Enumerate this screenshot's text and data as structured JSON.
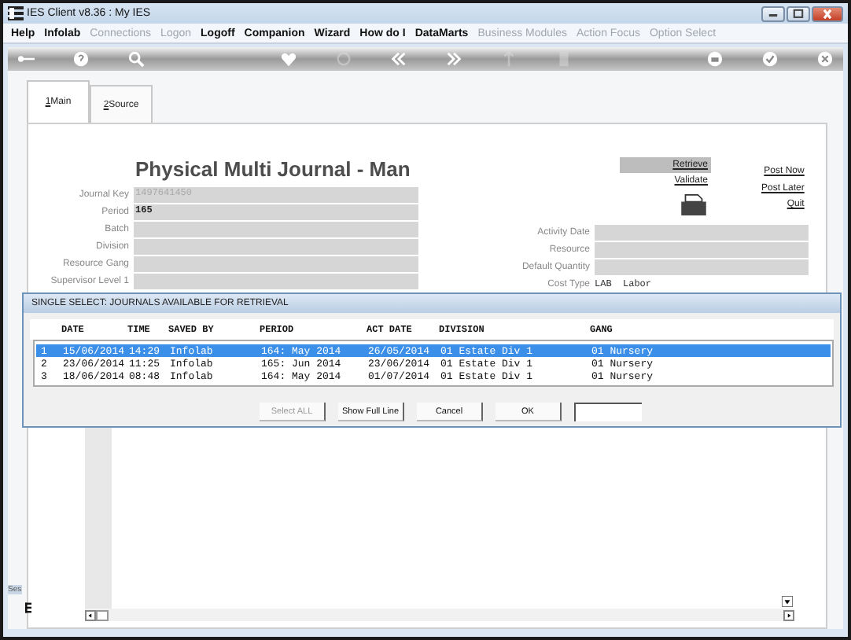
{
  "window": {
    "title": "IES Client v8.36 : My IES"
  },
  "menu": [
    {
      "label": "Help",
      "disabled": false
    },
    {
      "label": "Infolab",
      "disabled": false
    },
    {
      "label": "Connections",
      "disabled": true
    },
    {
      "label": "Logon",
      "disabled": true
    },
    {
      "label": "Logoff",
      "disabled": false
    },
    {
      "label": "Companion",
      "disabled": false
    },
    {
      "label": "Wizard",
      "disabled": false
    },
    {
      "label": "How do I",
      "disabled": false
    },
    {
      "label": "DataMarts",
      "disabled": false
    },
    {
      "label": "Business Modules",
      "disabled": true
    },
    {
      "label": "Action Focus",
      "disabled": true
    },
    {
      "label": "Option Select",
      "disabled": true
    }
  ],
  "toolbar": [
    {
      "kind": "key",
      "disabled": false
    },
    {
      "kind": "help",
      "disabled": false
    },
    {
      "kind": "search",
      "disabled": false
    },
    {
      "kind": "gap"
    },
    {
      "kind": "heart",
      "disabled": false
    },
    {
      "kind": "refresh",
      "disabled": true
    },
    {
      "kind": "back",
      "disabled": false
    },
    {
      "kind": "forward",
      "disabled": false
    },
    {
      "kind": "up",
      "disabled": true
    },
    {
      "kind": "square",
      "disabled": true
    },
    {
      "kind": "gap"
    },
    {
      "kind": "print",
      "disabled": false
    },
    {
      "kind": "check",
      "disabled": false
    },
    {
      "kind": "close",
      "disabled": false
    }
  ],
  "tabs": [
    {
      "key": "1",
      "label": " Main",
      "selected": true
    },
    {
      "key": "2",
      "label": " Source",
      "selected": false
    }
  ],
  "form": {
    "title": "Physical Multi Journal - Man",
    "left_fields": [
      {
        "label": "Journal Key",
        "value": "1497641450",
        "filled": false
      },
      {
        "label": "Period",
        "value": "165",
        "filled": true
      },
      {
        "label": "Batch"
      },
      {
        "label": "Division"
      },
      {
        "label": "Resource Gang"
      },
      {
        "label": "Supervisor Level 1"
      }
    ],
    "actions": [
      {
        "label": "Retrieve",
        "selected": true
      },
      {
        "label": "Validate",
        "selected": false
      }
    ],
    "post_actions": [
      "Post Now",
      "Post Later",
      "Quit"
    ],
    "right_fields": [
      {
        "label": "Activity Date",
        "kind": "field"
      },
      {
        "label": "Resource",
        "kind": "field"
      },
      {
        "label": "Default Quantity",
        "kind": "field"
      },
      {
        "label": "Cost Type",
        "kind": "text",
        "value": "LAB  Labor"
      }
    ]
  },
  "dialog": {
    "title": "SINGLE SELECT: JOURNALS AVAILABLE FOR RETRIEVAL",
    "columns": [
      "",
      "DATE",
      "TIME",
      "SAVED BY",
      "PERIOD",
      "ACT DATE",
      "DIVISION",
      "GANG"
    ],
    "rows": [
      {
        "cells": [
          "1",
          "15/06/2014",
          "14:29",
          "Infolab",
          "164: May 2014",
          "26/05/2014",
          "01 Estate Div 1",
          "01 Nursery"
        ],
        "selected": true
      },
      {
        "cells": [
          "2",
          "23/06/2014",
          "11:25",
          "Infolab",
          "165: Jun 2014",
          "23/06/2014",
          "01 Estate Div 1",
          "01 Nursery"
        ],
        "selected": false
      },
      {
        "cells": [
          "3",
          "18/06/2014",
          "08:48",
          "Infolab",
          "164: May 2014",
          "01/07/2014",
          "01 Estate Div 1",
          "01 Nursery"
        ],
        "selected": false
      }
    ],
    "buttons": [
      {
        "label": "Select ALL",
        "disabled": true
      },
      {
        "label": "Show Full Line",
        "disabled": false
      },
      {
        "label": "Cancel",
        "disabled": false
      },
      {
        "label": "OK",
        "disabled": false
      }
    ]
  },
  "side_label": "Ses"
}
